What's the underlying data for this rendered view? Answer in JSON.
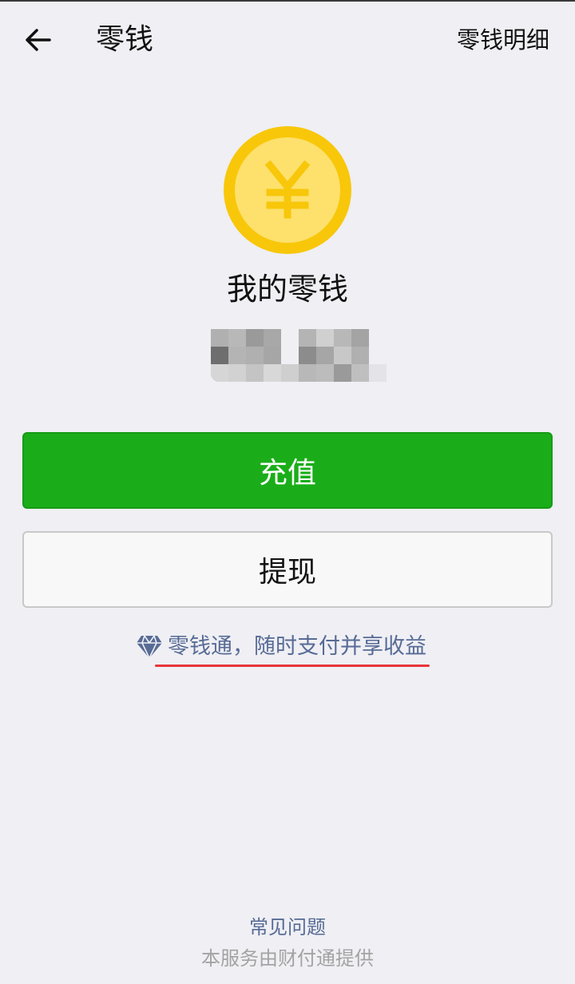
{
  "nav": {
    "title": "零钱",
    "action": "零钱明细"
  },
  "wallet": {
    "coin_symbol": "¥",
    "title": "我的零钱",
    "balance_obscured": true
  },
  "buttons": {
    "recharge": "充值",
    "withdraw": "提现"
  },
  "promo": {
    "icon": "diamond-icon",
    "text": "零钱通，随时支付并享收益"
  },
  "footer": {
    "faq": "常见问题",
    "provider": "本服务由财付通提供"
  },
  "colors": {
    "background": "#efeff4",
    "primary_green": "#1aad19",
    "link_blue": "#576b95",
    "coin_outer": "#f8c70a",
    "coin_inner": "#fde16c",
    "underline_red": "#e8363a"
  }
}
